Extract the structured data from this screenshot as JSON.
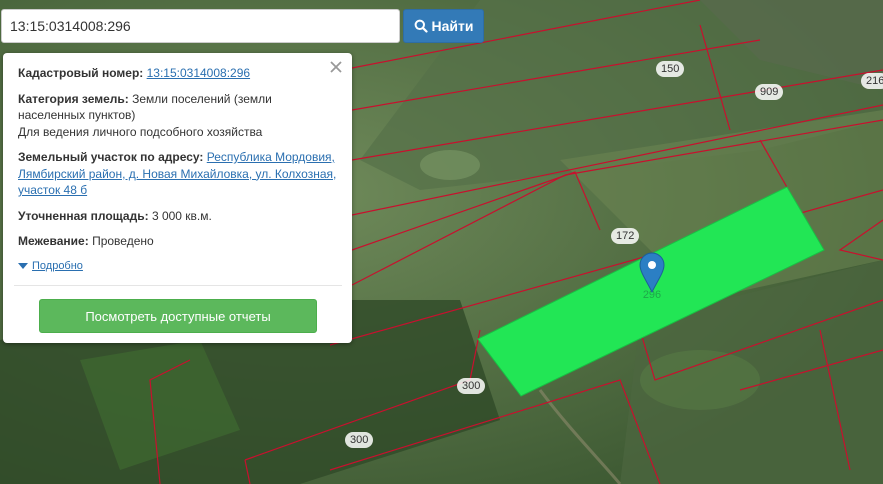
{
  "search": {
    "value": "13:15:0314008:296",
    "button_label": "Найти"
  },
  "popup": {
    "cadastral_label": "Кадастровый номер:",
    "cadastral_value": "13:15:0314008:296",
    "category_label": "Категория земель:",
    "category_value": "Земли поселений (земли населенных пунктов)",
    "usage_value": "Для ведения личного подсобного хозяйства",
    "address_label": "Земельный участок по адресу:",
    "address_value": "Республика Мордовия, Лямбирский район, д. Новая Михайловка, ул. Колхозная, участок 48 б",
    "area_label": "Уточненная площадь:",
    "area_value": "3 000 кв.м.",
    "survey_label": "Межевание:",
    "survey_value": "Проведено",
    "details_link": "Подробно",
    "report_button": "Посмотреть доступные отчеты"
  },
  "map": {
    "parcel_labels": [
      "150",
      "909",
      "216",
      "172",
      "300",
      "300"
    ],
    "selected_parcel_label": "296",
    "colors": {
      "selected_parcel": "#22e655",
      "boundary": "#c8102e",
      "marker": "#2b7fc4"
    }
  }
}
